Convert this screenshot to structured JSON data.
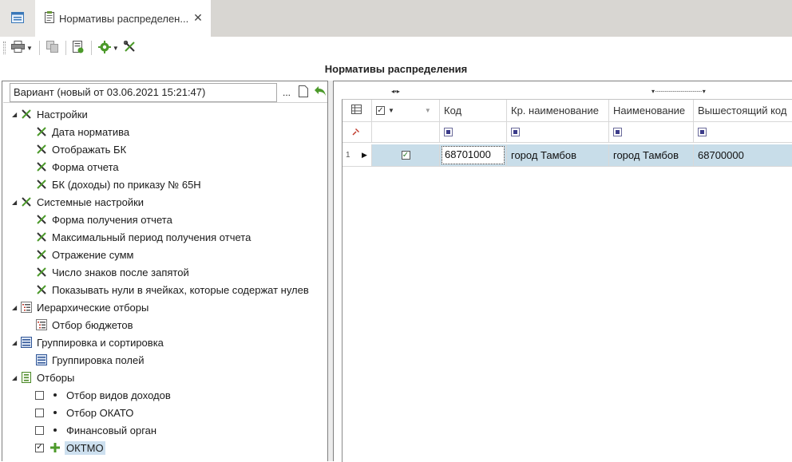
{
  "tabs": {
    "active_title": "Нормативы распределен...",
    "close_glyph": "✕"
  },
  "page": {
    "title": "Нормативы распределения"
  },
  "variant": {
    "label": "Вариант (новый от 03.06.2021 15:21:47)",
    "ellipsis": "..."
  },
  "tree": {
    "groups": [
      {
        "label": "Настройки",
        "icon": "wrench-cross-icon",
        "items": [
          "Дата норматива",
          "Отображать БК",
          "Форма отчета",
          "БК (доходы) по приказу № 65Н"
        ]
      },
      {
        "label": "Системные настройки",
        "icon": "wrench-cross-icon",
        "items": [
          "Форма получения отчета",
          "Максимальный период получения отчета",
          "Отражение сумм",
          "Число знаков после запятой",
          "Показывать нули в ячейках, которые содержат нулев"
        ]
      },
      {
        "label": "Иерархические отборы",
        "icon": "hierarchy-icon",
        "items": [
          "Отбор бюджетов"
        ]
      },
      {
        "label": "Группировка и сортировка",
        "icon": "grouping-icon",
        "items": [
          "Группировка полей"
        ]
      },
      {
        "label": "Отборы",
        "icon": "filter-list-icon",
        "items": [
          "Отбор видов доходов",
          "Отбор ОКАТО",
          "Финансовый орган",
          "ОКТМО"
        ]
      }
    ]
  },
  "grid": {
    "columns": [
      "Код",
      "Кр. наименование",
      "Наименование",
      "Вышестоящий код"
    ],
    "rows": [
      {
        "num": "1",
        "checked": true,
        "code": "68701000",
        "short_name": "город Тамбов",
        "name": "город Тамбов",
        "parent_code": "68700000"
      }
    ]
  },
  "colors": {
    "selection": "#c8dde9",
    "tab_strip": "#d8d6d2",
    "accent_green": "#3d8a2a"
  }
}
